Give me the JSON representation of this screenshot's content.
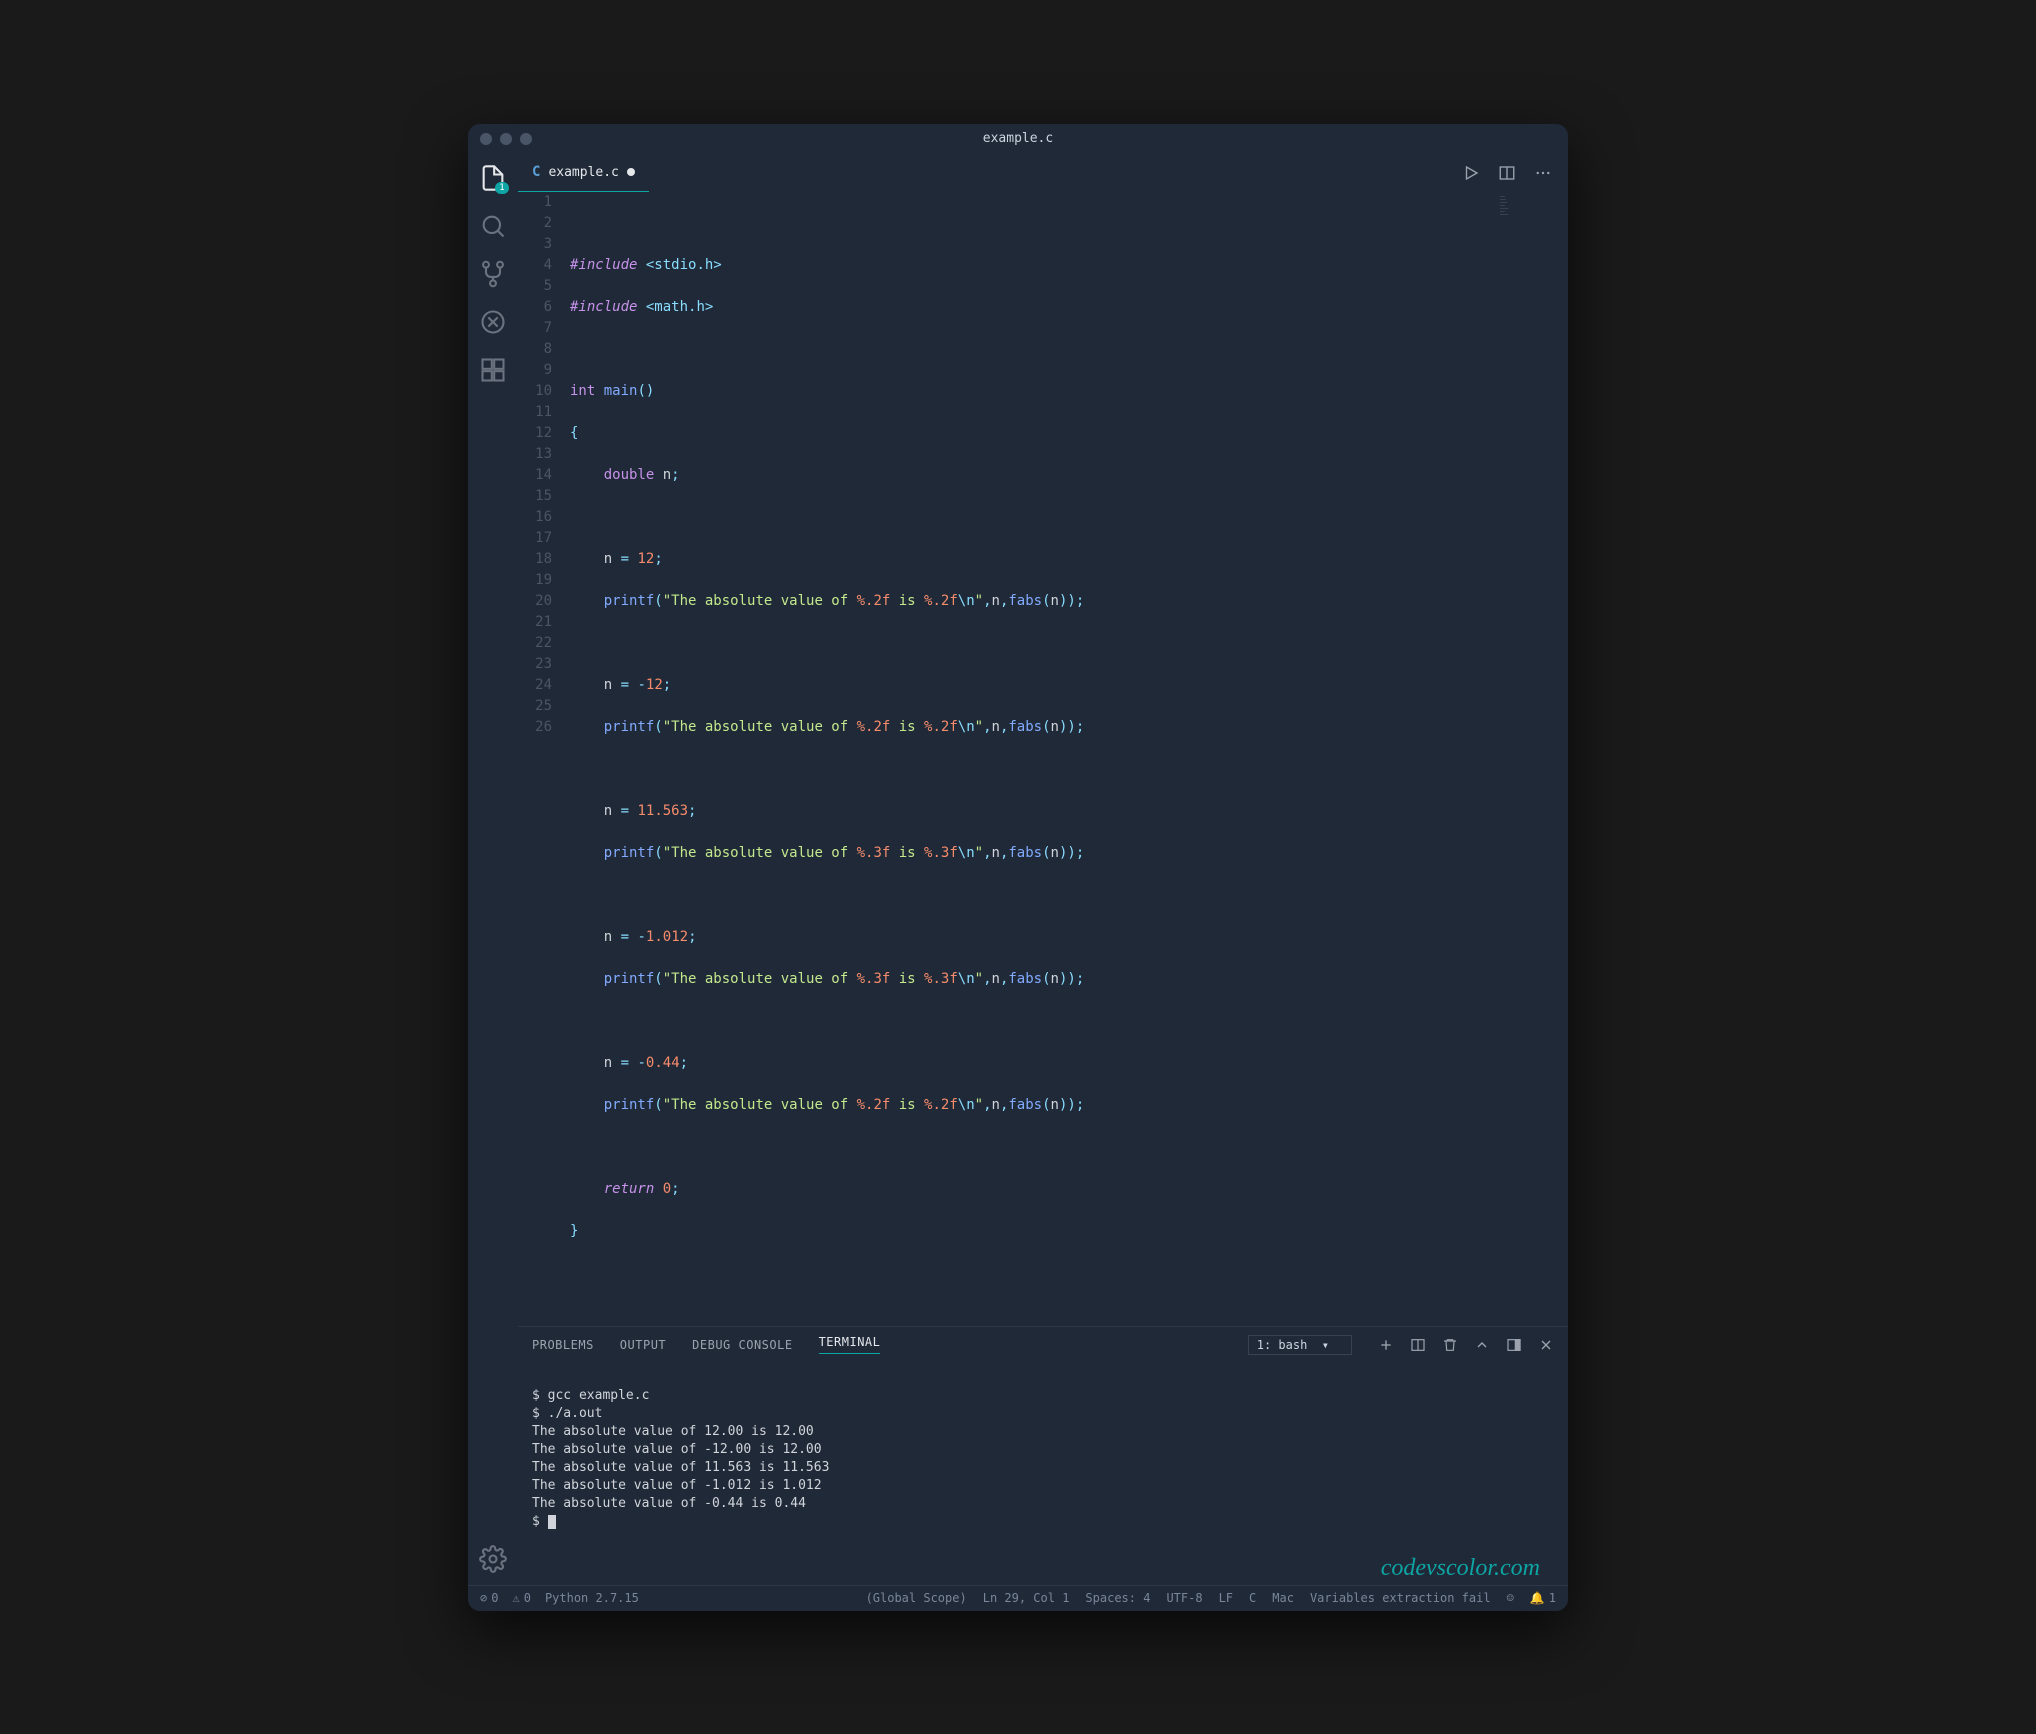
{
  "window": {
    "title": "example.c"
  },
  "tab": {
    "filename": "example.c",
    "lang_letter": "C"
  },
  "explorer_badge": "1",
  "line_numbers": [
    "1",
    "2",
    "3",
    "4",
    "5",
    "6",
    "7",
    "8",
    "9",
    "10",
    "11",
    "12",
    "13",
    "14",
    "15",
    "16",
    "17",
    "18",
    "19",
    "20",
    "21",
    "22",
    "23",
    "24",
    "25",
    "26"
  ],
  "code": {
    "l2": {
      "directive": "#include",
      "hdr": "<stdio.h>"
    },
    "l3": {
      "directive": "#include",
      "hdr": "<math.h>"
    },
    "l5": {
      "kw": "int",
      "fn": "main"
    },
    "l7": {
      "type": "double",
      "var": "n"
    },
    "l9": {
      "var": "n",
      "val": "12"
    },
    "l10": {
      "fn": "printf",
      "s1": "\"The absolute value of ",
      "fmt1": "%.2f",
      "s2": " is ",
      "fmt2": "%.2f",
      "esc": "\\n",
      "s3": "\"",
      "arg": "n",
      "fn2": "fabs",
      "arg2": "n"
    },
    "l12": {
      "var": "n",
      "op": "-",
      "val": "12"
    },
    "l13": {
      "fn": "printf",
      "s1": "\"The absolute value of ",
      "fmt1": "%.2f",
      "s2": " is ",
      "fmt2": "%.2f",
      "esc": "\\n",
      "s3": "\"",
      "arg": "n",
      "fn2": "fabs",
      "arg2": "n"
    },
    "l15": {
      "var": "n",
      "val": "11.563"
    },
    "l16": {
      "fn": "printf",
      "s1": "\"The absolute value of ",
      "fmt1": "%.3f",
      "s2": " is ",
      "fmt2": "%.3f",
      "esc": "\\n",
      "s3": "\"",
      "arg": "n",
      "fn2": "fabs",
      "arg2": "n"
    },
    "l18": {
      "var": "n",
      "op": "-",
      "val": "1.012"
    },
    "l19": {
      "fn": "printf",
      "s1": "\"The absolute value of ",
      "fmt1": "%.3f",
      "s2": " is ",
      "fmt2": "%.3f",
      "esc": "\\n",
      "s3": "\"",
      "arg": "n",
      "fn2": "fabs",
      "arg2": "n"
    },
    "l21": {
      "var": "n",
      "op": "-",
      "val": "0.44"
    },
    "l22": {
      "fn": "printf",
      "s1": "\"The absolute value of ",
      "fmt1": "%.2f",
      "s2": " is ",
      "fmt2": "%.2f",
      "esc": "\\n",
      "s3": "\"",
      "arg": "n",
      "fn2": "fabs",
      "arg2": "n"
    },
    "l24": {
      "kw": "return",
      "val": "0"
    }
  },
  "panel": {
    "tabs": {
      "problems": "PROBLEMS",
      "output": "OUTPUT",
      "debug": "DEBUG CONSOLE",
      "terminal": "TERMINAL"
    },
    "active": "terminal",
    "terminal_select": "1: bash"
  },
  "terminal": {
    "lines": [
      "$ gcc example.c",
      "$ ./a.out",
      "The absolute value of 12.00 is 12.00",
      "The absolute value of -12.00 is 12.00",
      "The absolute value of 11.563 is 11.563",
      "The absolute value of -1.012 is 1.012",
      "The absolute value of -0.44 is 0.44"
    ],
    "prompt": "$ "
  },
  "watermark": "codevscolor.com",
  "statusbar": {
    "errors": "0",
    "warnings": "0",
    "python": "Python 2.7.15",
    "scope": "(Global Scope)",
    "cursor": "Ln 29, Col 1",
    "spaces": "Spaces: 4",
    "encoding": "UTF-8",
    "eol": "LF",
    "lang": "C",
    "os": "Mac",
    "msg": "Variables extraction fail",
    "bell": "1"
  }
}
